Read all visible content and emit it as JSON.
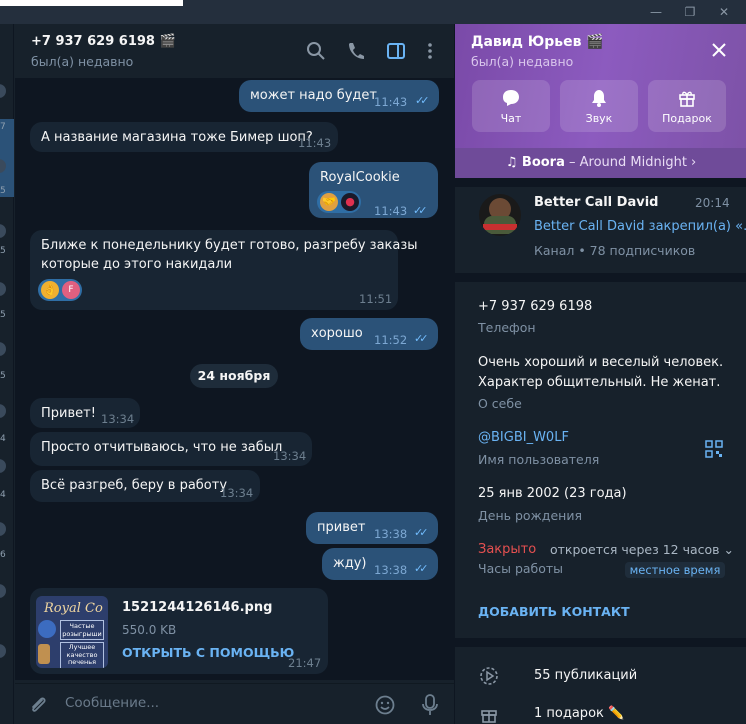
{
  "chat": {
    "title": "+7 937 629 6198 🎬",
    "status": "был(а) недавно",
    "date_separator": "24 ноября",
    "composer_placeholder": "Сообщение..."
  },
  "messages": [
    {
      "text": "может надо будет",
      "time": "11:43"
    },
    {
      "text": "А название магазина тоже Бимер шоп?",
      "time": "11:43"
    },
    {
      "text": "RoyalCookie",
      "time": "11:43"
    },
    {
      "text_line1": "Ближе к понедельнику будет готово, разгребу заказы",
      "text_line2": "которые до этого накидали",
      "time": "11:51"
    },
    {
      "text": "хорошо",
      "time": "11:52"
    },
    {
      "text": "Привет!",
      "time": "13:34"
    },
    {
      "text": "Просто отчитываюсь, что не забыл",
      "time": "13:34"
    },
    {
      "text": "Всё разгреб, беру в работу",
      "time": "13:34"
    },
    {
      "text": "привет",
      "time": "13:38"
    },
    {
      "text": "жду)",
      "time": "13:38"
    }
  ],
  "file_message": {
    "filename": "1521244126146.png",
    "size": "550.0 KB",
    "action": "ОТКРЫТЬ С ПОМОЩЬЮ",
    "time": "21:47",
    "thumb_title": "Royal Co",
    "thumb_lines": [
      "Частые",
      "розыгрыши",
      "Лучшее",
      "качество",
      "печенья"
    ]
  },
  "sidebar_numbers": [
    "7",
    "5",
    "5",
    "5",
    "5",
    "4",
    "4",
    "6"
  ],
  "profile": {
    "name": "Давид Юрьев 🎬",
    "status": "был(а) недавно",
    "actions": [
      "Чат",
      "Звук",
      "Подарок"
    ],
    "music_artist": "♫ Boora",
    "music_track": " – Around Midnight ›",
    "channel": {
      "name": "Better Call David",
      "time": "20:14",
      "pinned": "Better Call David закрепил(а) «...",
      "meta": "Канал • 78 подписчиков"
    },
    "phone": "+7 937 629 6198",
    "phone_label": "Телефон",
    "bio_line1": "Очень хороший и веселый человек.",
    "bio_line2": "Характер общительный. Не женат.",
    "bio_label": "О себе",
    "username": "@BIGBI_W0LF",
    "username_label": "Имя пользователя",
    "birthday": "25 янв 2002 (23 года)",
    "birthday_label": "День рождения",
    "closed": "Закрыто",
    "opens": "откроется через 12 часов ⌄",
    "hours_label": "Часы работы",
    "local_time": "местное время",
    "add_contact": "ДОБАВИТЬ КОНТАКТ",
    "publications": "55 публикаций",
    "gifts": "1 подарок ✏️"
  },
  "colors": {
    "outgoing": "#2b5278",
    "incoming": "#182533",
    "accent": "#6ab3f3",
    "closed": "#e55050",
    "profile_header": "#8c5bbf"
  }
}
